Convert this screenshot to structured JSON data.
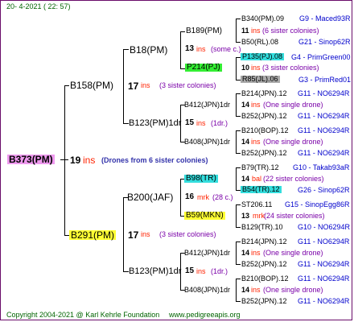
{
  "date": "20-  4-2021 ( 22: 57)",
  "root": {
    "name": "B373(PM)",
    "count": "19",
    "ins": "ins",
    "note": "(Drones from 6 sister colonies)"
  },
  "g1": [
    {
      "name": "B158(PM)",
      "count": "17",
      "ins": "ins",
      "note": "(3 sister colonies)"
    },
    {
      "name": "B291(PM)",
      "count": "17",
      "ins": "ins",
      "note": "(3 sister colonies)"
    }
  ],
  "g2": [
    {
      "name": "B18(PM)",
      "count": "13",
      "ins": "ins",
      "note": "(some c.)"
    },
    {
      "name": "B123(PM)1dr",
      "count": "15",
      "ins": "ins",
      "note": "(1dr.)"
    },
    {
      "name": "B200(JAF)",
      "count": "16",
      "ins": "mrk",
      "note": "(28 c.)"
    },
    {
      "name": "B123(PM)1dr",
      "count": "15",
      "ins": "ins",
      "note": "(1dr.)"
    }
  ],
  "g3": [
    {
      "name": "B189(PM)",
      "count": "11",
      "ins": "ins",
      "note": "(6 sister colonies)"
    },
    {
      "name": "P214(PJ)",
      "count": "10",
      "ins": "ins",
      "note": "(3 sister colonies)"
    },
    {
      "name": "B412(JPN)1dr",
      "count": "14",
      "ins": "ins",
      "note": "(One single drone)"
    },
    {
      "name": "B408(JPN)1dr",
      "count": "14",
      "ins": "ins",
      "note": "(One single drone)"
    },
    {
      "name": "B98(TR)",
      "count": "14",
      "ins": "bal",
      "note": "(22 sister colonies)"
    },
    {
      "name": "B59(MKN)",
      "count": "13",
      "ins": "mrk",
      "note": "(24 sister colonies)"
    },
    {
      "name": "B412(JPN)1dr",
      "count": "14",
      "ins": "ins",
      "note": "(One single drone)"
    },
    {
      "name": "B408(JPN)1dr",
      "count": "14",
      "ins": "ins",
      "note": "(One single drone)"
    }
  ],
  "g4": [
    {
      "name": "B340(PM).09",
      "info": "G9 - Maced93R"
    },
    {
      "name": "B50(RL).08",
      "info": "G21 - Sinop62R"
    },
    {
      "name": "P135(PJ).08",
      "info": "G4 - PrimGreen00"
    },
    {
      "name": "R85(JL).06",
      "info": "G3 - PrimRed01"
    },
    {
      "name": "B214(JPN).12",
      "info": "G11 - NO6294R"
    },
    {
      "name": "B252(JPN).12",
      "info": "G11 - NO6294R"
    },
    {
      "name": "B210(BOP).12",
      "info": "G11 - NO6294R"
    },
    {
      "name": "B252(JPN).12",
      "info": "G11 - NO6294R"
    },
    {
      "name": "B79(TR).12",
      "info": "G10 - Takab93aR"
    },
    {
      "name": "B54(TR).12",
      "info": "G26 - Sinop62R"
    },
    {
      "name": "ST206.11",
      "info": "G15 - SinopEgg86R"
    },
    {
      "name": "B129(TR).10",
      "info": "G10 - NO6294R"
    },
    {
      "name": "B214(JPN).12",
      "info": "G11 - NO6294R"
    },
    {
      "name": "B252(JPN).12",
      "info": "G11 - NO6294R"
    },
    {
      "name": "B210(BOP).12",
      "info": "G11 - NO6294R"
    },
    {
      "name": "B252(JPN).12",
      "info": "G11 - NO6294R"
    }
  ],
  "footer": {
    "copyright": "Copyright 2004-2021 @ Karl Kehrle Foundation",
    "url": "www.pedigreeapis.org"
  },
  "colors": {
    "pink": "#ee99ee",
    "yellow": "#ffff33",
    "green": "#33ee33",
    "cyan": "#33dddd",
    "grey": "#aaaaaa",
    "frame": "#6a0c6a"
  }
}
